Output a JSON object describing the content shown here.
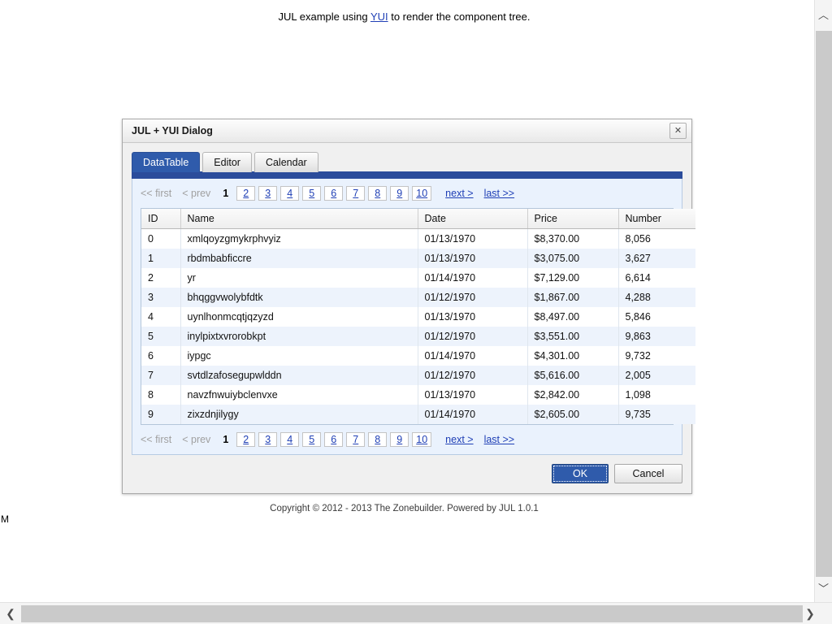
{
  "page": {
    "header_prefix": "JUL example using ",
    "header_link": "YUI",
    "header_suffix": " to render the component tree.",
    "copyright": "Copyright © 2012 - 2013 The Zonebuilder. Powered by JUL 1.0.1",
    "corner_text": "M"
  },
  "dialog": {
    "title": "JUL + YUI Dialog",
    "close_label": "✕",
    "tabs": [
      {
        "label": "DataTable",
        "active": true
      },
      {
        "label": "Editor",
        "active": false
      },
      {
        "label": "Calendar",
        "active": false
      }
    ],
    "footer": {
      "ok_label": "OK",
      "cancel_label": "Cancel"
    }
  },
  "pager": {
    "first_label": "<< first",
    "prev_label": "< prev",
    "current_page": "1",
    "pages": [
      "2",
      "3",
      "4",
      "5",
      "6",
      "7",
      "8",
      "9",
      "10"
    ],
    "next_label": "next >",
    "last_label": "last >>"
  },
  "table": {
    "columns": [
      "ID",
      "Name",
      "Date",
      "Price",
      "Number"
    ],
    "rows": [
      {
        "id": "0",
        "name": "xmlqoyzgmykrphvyiz",
        "date": "01/13/1970",
        "price": "$8,370.00",
        "number": "8,056"
      },
      {
        "id": "1",
        "name": "rbdmbabficcre",
        "date": "01/13/1970",
        "price": "$3,075.00",
        "number": "3,627"
      },
      {
        "id": "2",
        "name": "yr",
        "date": "01/14/1970",
        "price": "$7,129.00",
        "number": "6,614"
      },
      {
        "id": "3",
        "name": "bhqggvwolybfdtk",
        "date": "01/12/1970",
        "price": "$1,867.00",
        "number": "4,288"
      },
      {
        "id": "4",
        "name": "uynlhonmcqtjqzyzd",
        "date": "01/13/1970",
        "price": "$8,497.00",
        "number": "5,846"
      },
      {
        "id": "5",
        "name": "inylpixtxvrorobkpt",
        "date": "01/12/1970",
        "price": "$3,551.00",
        "number": "9,863"
      },
      {
        "id": "6",
        "name": "iypgc",
        "date": "01/14/1970",
        "price": "$4,301.00",
        "number": "9,732"
      },
      {
        "id": "7",
        "name": "svtdlzafosegupwlddn",
        "date": "01/12/1970",
        "price": "$5,616.00",
        "number": "2,005"
      },
      {
        "id": "8",
        "name": "navzfnwuiybclenvxe",
        "date": "01/13/1970",
        "price": "$2,842.00",
        "number": "1,098"
      },
      {
        "id": "9",
        "name": "zixzdnjilygy",
        "date": "01/14/1970",
        "price": "$2,605.00",
        "number": "9,735"
      }
    ]
  },
  "scrollbars": {
    "up_arrow": "︿",
    "down_arrow": "﹀",
    "left_arrow": "❮",
    "right_arrow": "❯"
  },
  "colors": {
    "accent_blue": "#2f5bab",
    "tab_bar_blue": "#2b4c9b",
    "link_blue": "#1f3fb5",
    "row_stripe": "#edf3fc",
    "panel_bg": "#eaf2fd"
  }
}
